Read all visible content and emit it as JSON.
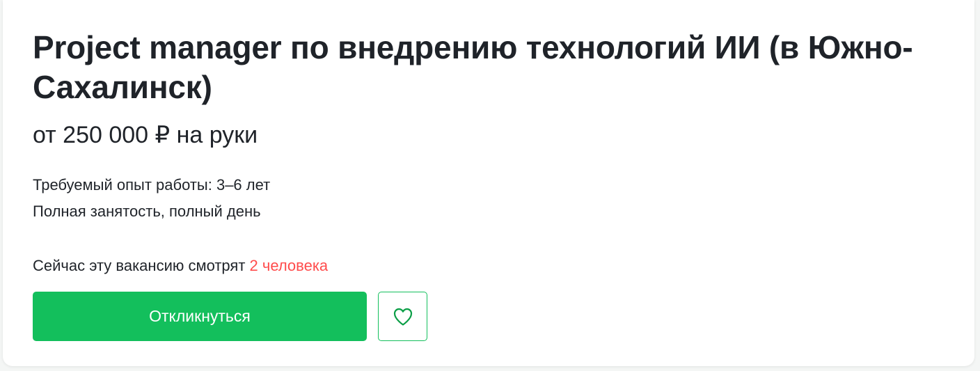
{
  "vacancy": {
    "title": "Project manager по внедрению технологий ИИ (в Южно-Сахалинск)",
    "salary": "от 250 000 ₽ на руки",
    "experience": "Требуемый опыт работы: 3–6 лет",
    "employment": "Полная занятость, полный день"
  },
  "viewers": {
    "prefix": "Сейчас эту вакансию смотрят ",
    "count_text": "2 человека",
    "highlight_color": "#ff4c4c"
  },
  "actions": {
    "apply_label": "Откликнуться",
    "apply_color": "#13bf5c",
    "favorite_icon": "heart-outline-icon"
  }
}
